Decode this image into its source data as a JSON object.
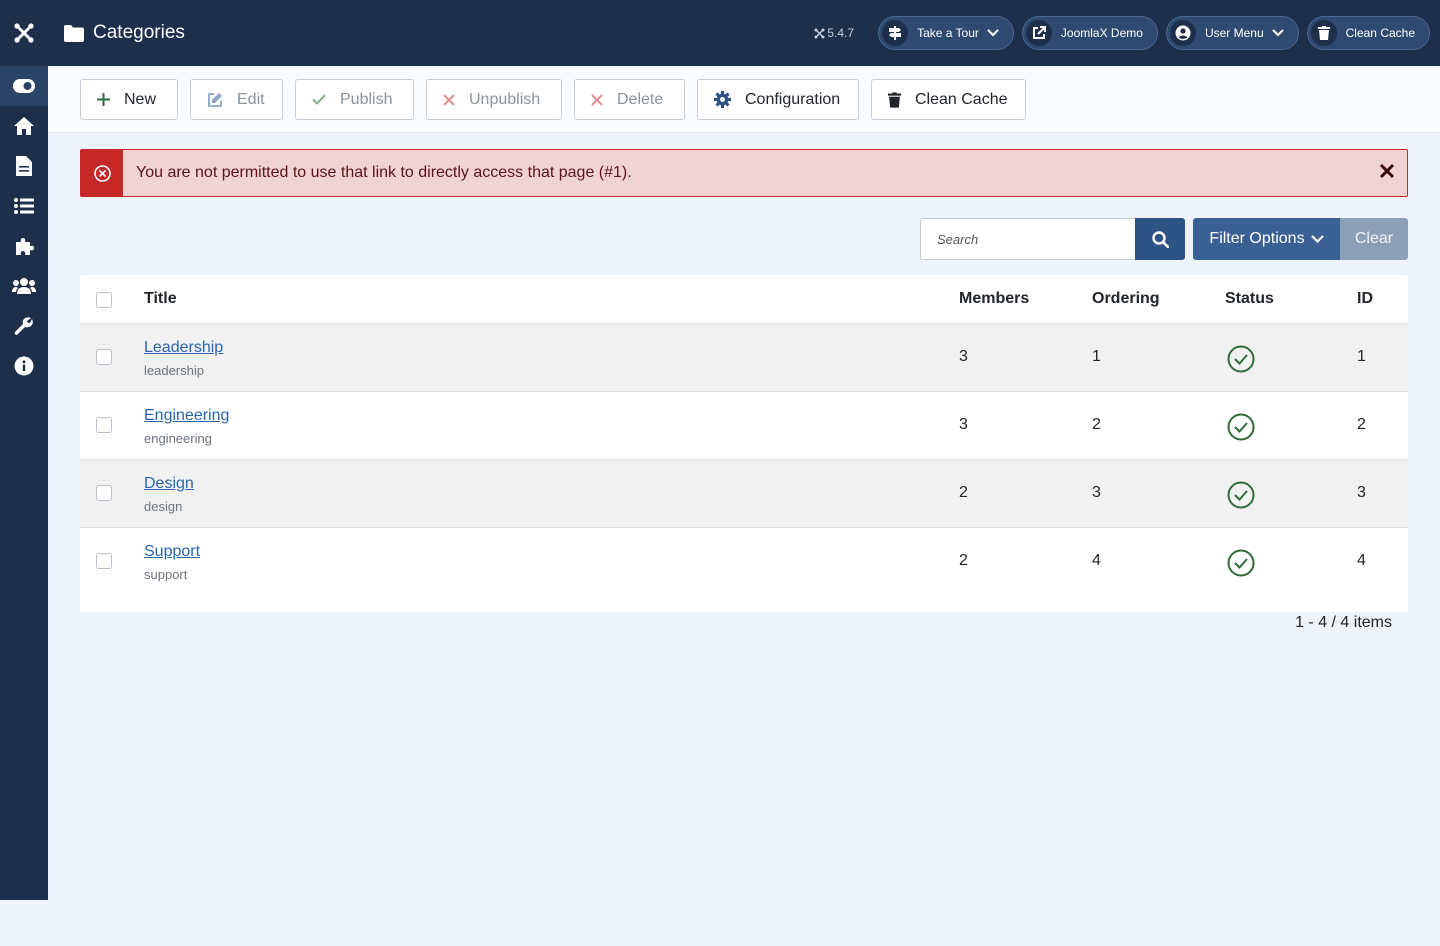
{
  "header": {
    "title": "Categories",
    "version": "5.4.7",
    "buttons": {
      "tour": "Take a Tour",
      "demo": "JoomlaX Demo",
      "user_menu": "User Menu",
      "clean_cache": "Clean Cache"
    }
  },
  "sidebar": {
    "items": [
      "toggle-icon",
      "home-icon",
      "file-icon",
      "list-icon",
      "puzzle-icon",
      "users-icon",
      "wrench-icon",
      "info-icon"
    ]
  },
  "toolbar": {
    "new": "New",
    "edit": "Edit",
    "publish": "Publish",
    "unpublish": "Unpublish",
    "delete": "Delete",
    "configuration": "Configuration",
    "clean_cache": "Clean Cache"
  },
  "alert": {
    "message": "You are not permitted to use that link to directly access that page (#1)."
  },
  "search": {
    "placeholder": "Search",
    "filter_label": "Filter Options",
    "clear_label": "Clear"
  },
  "table": {
    "headers": {
      "title": "Title",
      "members": "Members",
      "ordering": "Ordering",
      "status": "Status",
      "id": "ID"
    },
    "rows": [
      {
        "title": "Leadership",
        "alias": "leadership",
        "members": "3",
        "ordering": "1",
        "status": "published",
        "id": "1"
      },
      {
        "title": "Engineering",
        "alias": "engineering",
        "members": "3",
        "ordering": "2",
        "status": "published",
        "id": "2"
      },
      {
        "title": "Design",
        "alias": "design",
        "members": "2",
        "ordering": "3",
        "status": "published",
        "id": "3"
      },
      {
        "title": "Support",
        "alias": "support",
        "members": "2",
        "ordering": "4",
        "status": "published",
        "id": "4"
      }
    ]
  },
  "pagination": {
    "summary": "1 - 4 / 4 items"
  },
  "colors": {
    "header_bg": "#1e2f4b",
    "primary": "#2e5486",
    "danger": "#c52827",
    "success": "#2f6b3c",
    "link": "#2a66b0"
  }
}
